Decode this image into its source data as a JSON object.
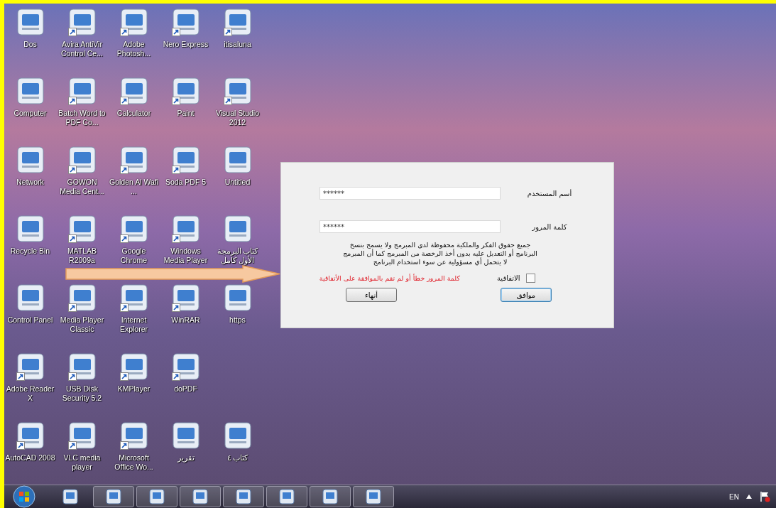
{
  "desktop": {
    "rows": [
      [
        {
          "label": "Dos",
          "shortcut": false
        },
        {
          "label": "Avira AntiVir Control Ce...",
          "shortcut": true
        },
        {
          "label": "Adobe Photosh...",
          "shortcut": true
        },
        {
          "label": "Nero Express",
          "shortcut": true
        },
        {
          "label": "itisaluna",
          "shortcut": true
        }
      ],
      [
        {
          "label": "Computer",
          "shortcut": false
        },
        {
          "label": "Batch Word to PDF Co...",
          "shortcut": true
        },
        {
          "label": "Calculator",
          "shortcut": true
        },
        {
          "label": "Paint",
          "shortcut": true
        },
        {
          "label": "Visual Studio 2012",
          "shortcut": true
        }
      ],
      [
        {
          "label": "Network",
          "shortcut": false
        },
        {
          "label": "GOWON Media Cent...",
          "shortcut": true
        },
        {
          "label": "Golden Al Wafi ...",
          "shortcut": true
        },
        {
          "label": "Soda PDF 5",
          "shortcut": true
        },
        {
          "label": "Untitled",
          "shortcut": false
        }
      ],
      [
        {
          "label": "Recycle Bin",
          "shortcut": false
        },
        {
          "label": "MATLAB R2009a",
          "shortcut": true
        },
        {
          "label": "Google Chrome",
          "shortcut": true
        },
        {
          "label": "Windows Media Player",
          "shortcut": true
        },
        {
          "label": "كتاب البرمجة الأول كامل",
          "shortcut": false
        }
      ],
      [
        {
          "label": "Control Panel",
          "shortcut": false
        },
        {
          "label": "Media Player Classic",
          "shortcut": true
        },
        {
          "label": "Internet Explorer",
          "shortcut": true
        },
        {
          "label": "WinRAR",
          "shortcut": true
        },
        {
          "label": "https",
          "shortcut": false
        }
      ],
      [
        {
          "label": "Adobe Reader X",
          "shortcut": true
        },
        {
          "label": "USB Disk Security 5.2",
          "shortcut": true
        },
        {
          "label": "KMPlayer",
          "shortcut": true
        },
        {
          "label": "doPDF",
          "shortcut": true
        }
      ],
      [
        {
          "label": "AutoCAD 2008",
          "shortcut": true
        },
        {
          "label": "VLC media player",
          "shortcut": true
        },
        {
          "label": "Microsoft Office Wo...",
          "shortcut": true
        },
        {
          "label": "تقرير",
          "shortcut": false
        },
        {
          "label": "كتاب ٤",
          "shortcut": false
        }
      ]
    ]
  },
  "dialog": {
    "fields": [
      {
        "label": "أسم المستخدم",
        "value": "******"
      },
      {
        "label": "كلمة المرور",
        "value": "******"
      }
    ],
    "notice": "جميع حقوق الفكر والملكية محفوظة لدى المبرمج ولا يسمح بنسخ البرنامج أو التعديل عليه بدون أخذ الرخصة من المبرمج كما أن المبرمج لا يتحمل أي مسؤولية عن سوء استخدام البرنامج",
    "agreement": {
      "label": "الاتفاقية",
      "checked": false
    },
    "error": "كلمة المرور خطأ أو لم تقم بالموافقة على الأتفاقية",
    "buttons": [
      {
        "label": "موافق",
        "default": true
      },
      {
        "label": "أنهاء",
        "default": false
      }
    ]
  },
  "taskbar": {
    "items": [
      {
        "running": false
      },
      {
        "running": true
      },
      {
        "running": true
      },
      {
        "running": true
      },
      {
        "running": true
      },
      {
        "running": true
      },
      {
        "running": true
      },
      {
        "running": true
      }
    ],
    "language": "EN"
  }
}
